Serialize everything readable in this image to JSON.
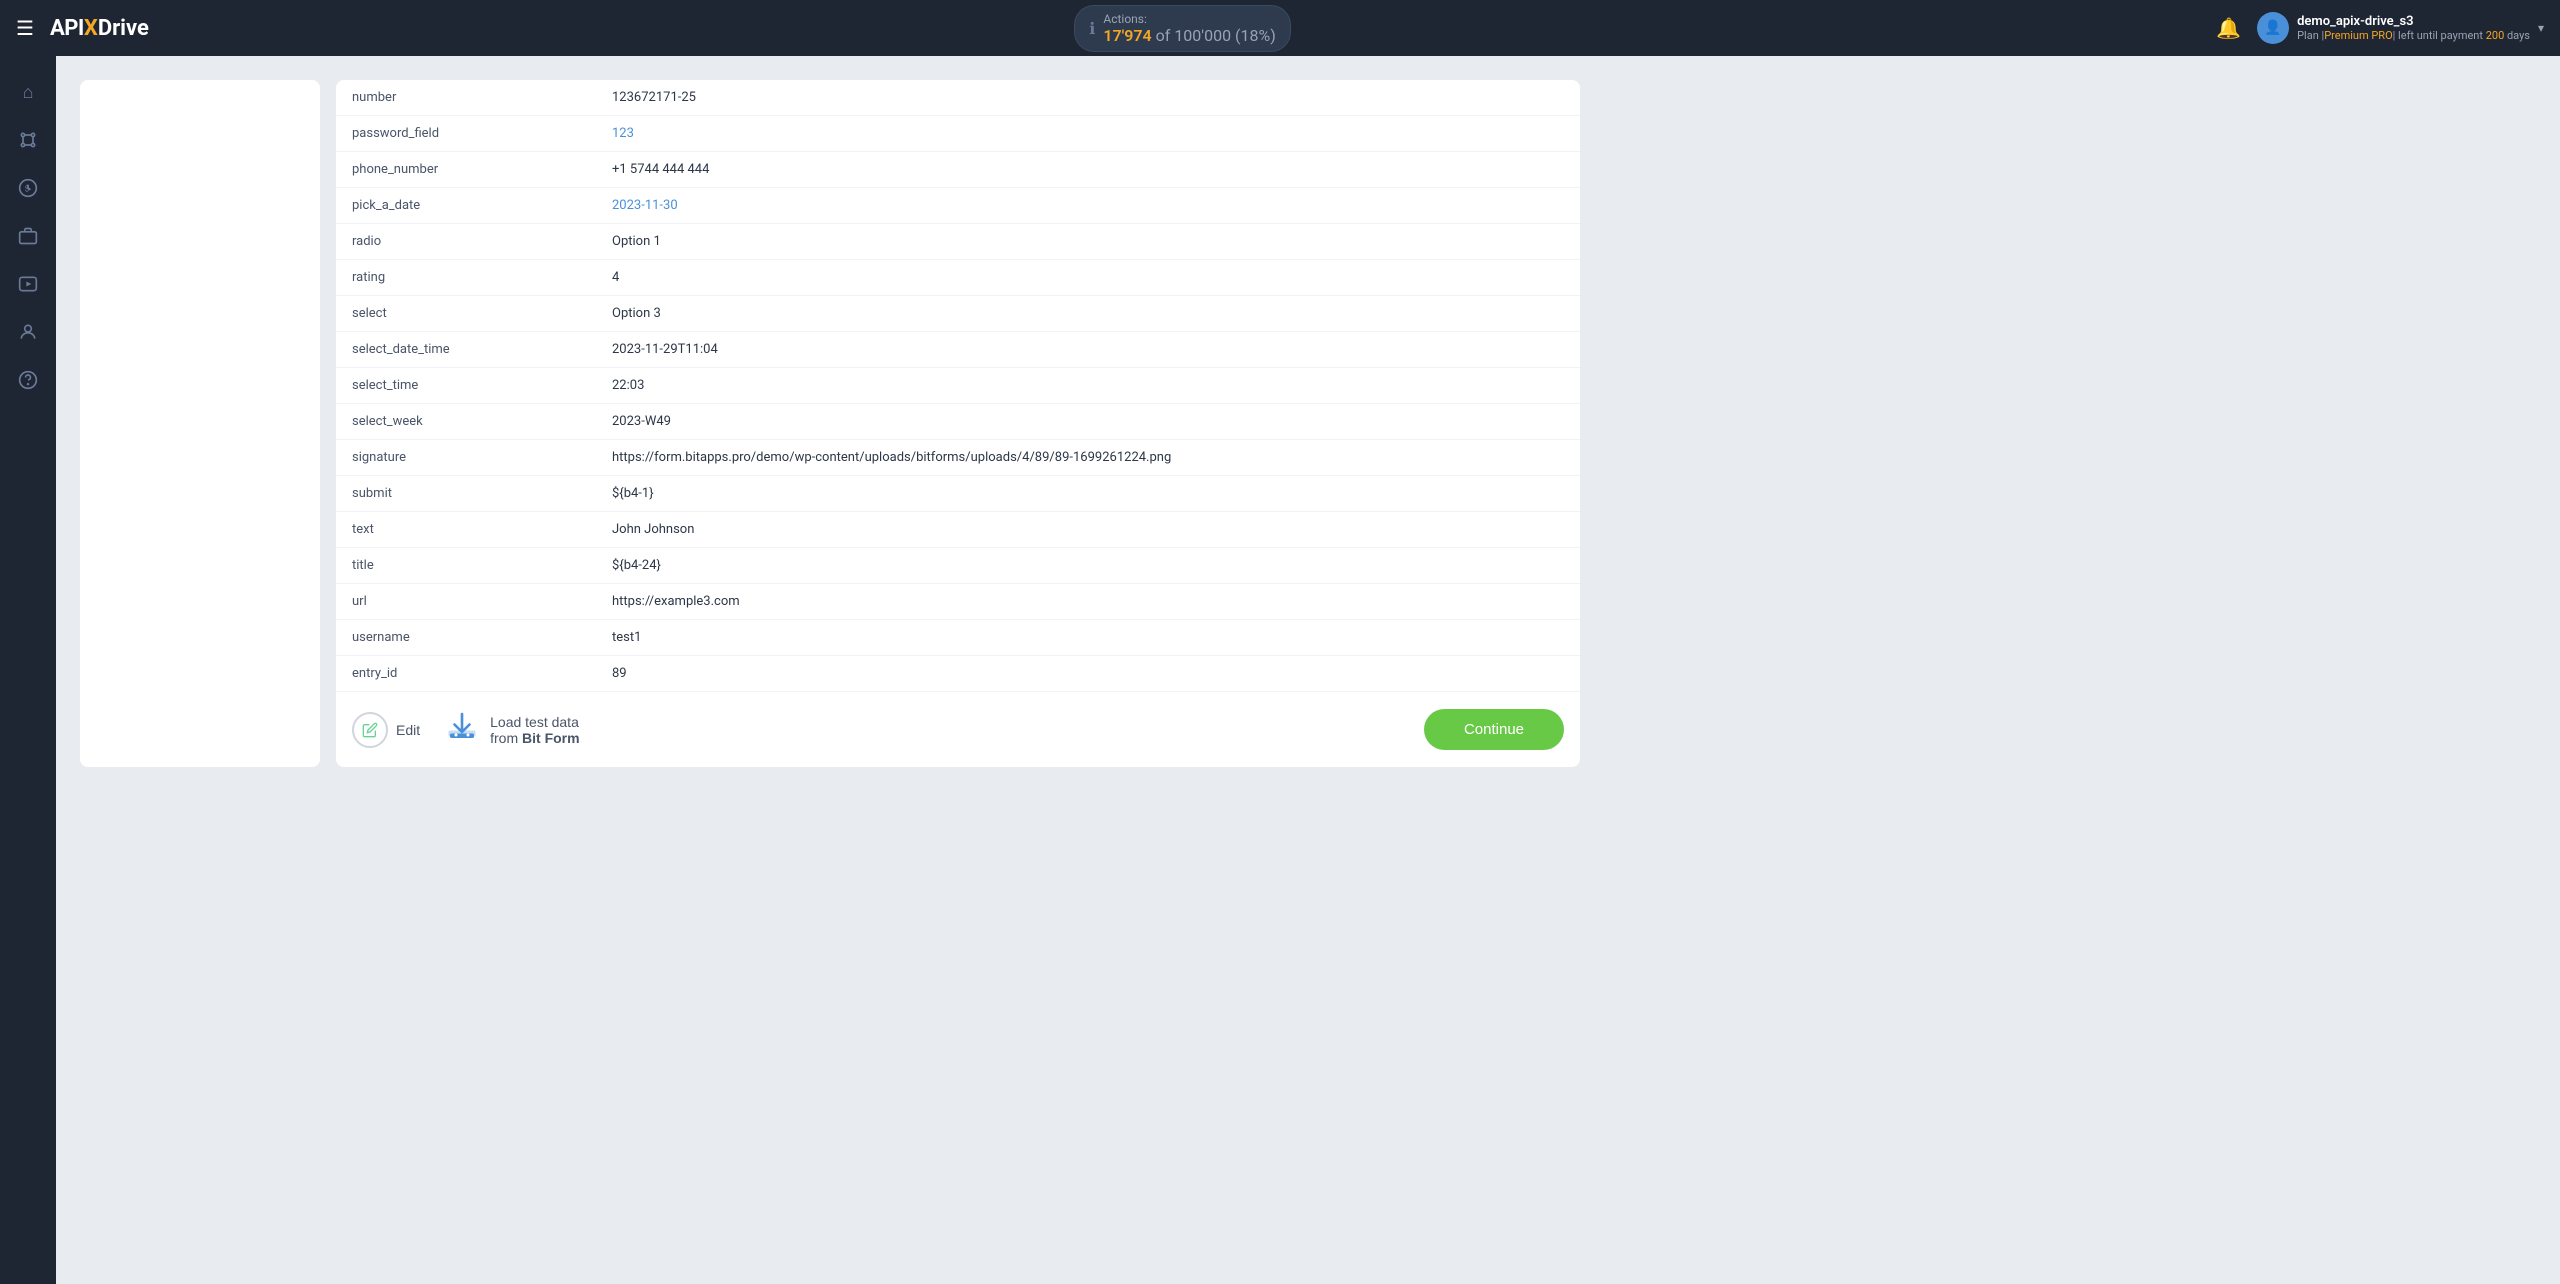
{
  "topnav": {
    "menu_icon": "☰",
    "logo_api": "API",
    "logo_x": "X",
    "logo_drive": "Drive",
    "actions_label": "Actions:",
    "actions_used": "17'974",
    "actions_of": "of",
    "actions_total": "100'000",
    "actions_pct": "(18%)",
    "bell_icon": "🔔",
    "user_name": "demo_apix-drive_s3",
    "user_plan_prefix": "Plan |",
    "user_plan_tier": "Premium PRO",
    "user_plan_suffix": "| left until payment",
    "user_plan_days": "200",
    "user_plan_days_suffix": "days",
    "chevron": "▾"
  },
  "sidebar": {
    "items": [
      {
        "id": "home",
        "icon": "⌂",
        "label": "home-icon"
      },
      {
        "id": "connections",
        "icon": "⋮⋮",
        "label": "connections-icon"
      },
      {
        "id": "billing",
        "icon": "$",
        "label": "billing-icon"
      },
      {
        "id": "briefcase",
        "icon": "💼",
        "label": "briefcase-icon"
      },
      {
        "id": "youtube",
        "icon": "▶",
        "label": "youtube-icon"
      },
      {
        "id": "profile",
        "icon": "👤",
        "label": "profile-icon"
      },
      {
        "id": "help",
        "icon": "?",
        "label": "help-icon"
      }
    ]
  },
  "table": {
    "rows": [
      {
        "field": "number",
        "value": "123672171-25",
        "style": "normal"
      },
      {
        "field": "password_field",
        "value": "123",
        "style": "link"
      },
      {
        "field": "phone_number",
        "value": "+1 5744 444 444",
        "style": "normal"
      },
      {
        "field": "pick_a_date",
        "value": "2023-11-30",
        "style": "link"
      },
      {
        "field": "radio",
        "value": "Option 1",
        "style": "normal"
      },
      {
        "field": "rating",
        "value": "4",
        "style": "normal"
      },
      {
        "field": "select",
        "value": "Option 3",
        "style": "normal"
      },
      {
        "field": "select_date_time",
        "value": "2023-11-29T11:04",
        "style": "normal"
      },
      {
        "field": "select_time",
        "value": "22:03",
        "style": "normal"
      },
      {
        "field": "select_week",
        "value": "2023-W49",
        "style": "normal"
      },
      {
        "field": "signature",
        "value": "https://form.bitapps.pro/demo/wp-content/uploads/bitforms/uploads/4/89/89-1699261224.png",
        "style": "normal"
      },
      {
        "field": "submit",
        "value": "${b4-1}",
        "style": "normal"
      },
      {
        "field": "text",
        "value": "John Johnson",
        "style": "normal"
      },
      {
        "field": "title",
        "value": "${b4-24}",
        "style": "normal"
      },
      {
        "field": "url",
        "value": "https://example3.com",
        "style": "normal"
      },
      {
        "field": "username",
        "value": "test1",
        "style": "normal"
      },
      {
        "field": "entry_id",
        "value": "89",
        "style": "normal"
      }
    ]
  },
  "footer": {
    "edit_label": "Edit",
    "load_label_prefix": "Load test data",
    "load_label_from": "from",
    "load_label_service": "Bit Form",
    "continue_label": "Continue"
  }
}
